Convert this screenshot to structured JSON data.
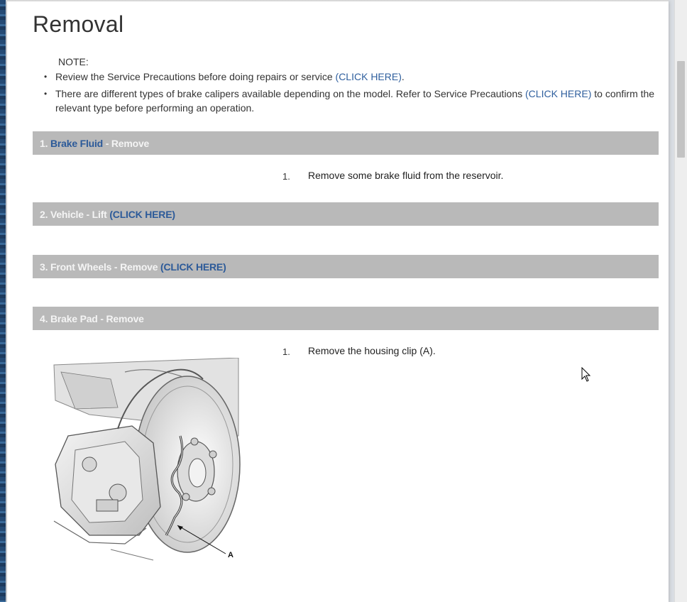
{
  "page": {
    "title": "Removal",
    "note_label": "NOTE:",
    "notes": [
      {
        "text": "Review the Service Precautions before doing repairs or service ",
        "link": "(CLICK HERE)",
        "after": "."
      },
      {
        "text": "There are different types of brake calipers available depending on the model. Refer to Service Precautions ",
        "link": "(CLICK HERE)",
        "after": " to confirm the relevant type before performing an operation."
      }
    ]
  },
  "steps": [
    {
      "number": "1.",
      "link": "Brake Fluid",
      "suffix": " - Remove",
      "instruction": {
        "num": "1.",
        "text": "Remove some brake fluid from the reservoir."
      }
    },
    {
      "label": "2. Vehicle - Lift ",
      "link": "(CLICK HERE)"
    },
    {
      "label": "3. Front Wheels - Remove ",
      "link": "(CLICK HERE)"
    },
    {
      "label": "4. Brake Pad - Remove",
      "instruction": {
        "num": "1.",
        "text": "Remove the housing clip (A)."
      },
      "figure_callout": "A"
    }
  ],
  "colors": {
    "step_bar": "#b9b9b9",
    "link": "#2f5f9e",
    "text": "#333333"
  },
  "icons": {
    "cursor": "arrow-cursor-icon",
    "figure": "brake-caliper-illustration"
  }
}
